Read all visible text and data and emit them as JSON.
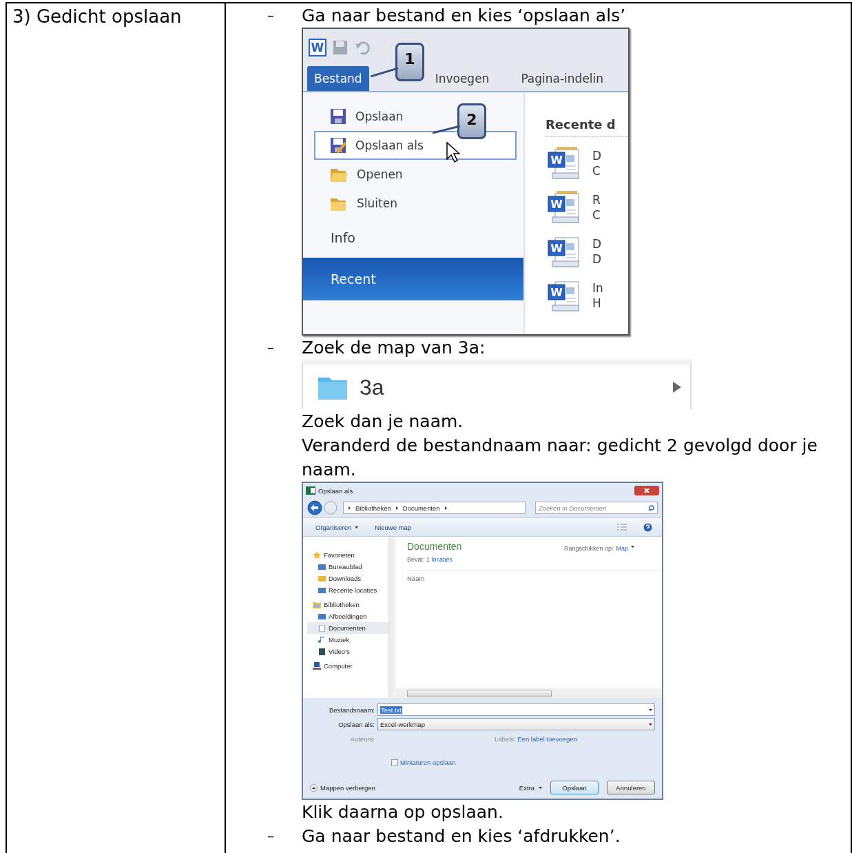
{
  "step_label": "3) Gedicht opslaan",
  "blocks": [
    {
      "kind": "bullet",
      "marker": "–",
      "text": "Ga naar bestand en kies ‘opslaan als’"
    },
    {
      "kind": "word_menu",
      "app_letter": "W",
      "tabs": [
        {
          "label": "Bestand",
          "selected": true
        },
        {
          "label": "Invoegen",
          "selected": false
        },
        {
          "label": "Pagina-indelin",
          "selected": false
        }
      ],
      "items": [
        {
          "kind": "command",
          "label": "Opslaan",
          "selected": false
        },
        {
          "kind": "command",
          "label": "Opslaan als",
          "selected": true
        },
        {
          "kind": "command",
          "label": "Openen",
          "selected": false
        },
        {
          "kind": "command",
          "label": "Sluiten",
          "selected": false
        },
        {
          "kind": "section",
          "label": "Info",
          "selected": false
        },
        {
          "kind": "section",
          "label": "Recent",
          "selected": true
        }
      ],
      "recent_heading": "Recente d",
      "recent_docs": [
        {
          "icon_letter": "W",
          "line1": "D",
          "line2": "C"
        },
        {
          "icon_letter": "W",
          "line1": "R",
          "line2": "C"
        },
        {
          "icon_letter": "W",
          "line1": "D",
          "line2": "D"
        },
        {
          "icon_letter": "W",
          "line1": "In",
          "line2": "H"
        }
      ],
      "callouts": [
        "1",
        "2"
      ]
    },
    {
      "kind": "bullet",
      "marker": "–",
      "text": "Zoek de map van 3a:"
    },
    {
      "kind": "folder_row",
      "name": "3a"
    },
    {
      "kind": "text",
      "text": "Zoek dan je naam."
    },
    {
      "kind": "text",
      "text": "Veranderd de bestandnaam naar: gedicht 2 gevolgd door je naam."
    },
    {
      "kind": "save_dialog",
      "title": "Opslaan als",
      "breadcrumbs": [
        "Bibliotheken",
        "Documenten"
      ],
      "search": {
        "placeholder": "Zoeken in Documenten"
      },
      "toolbar": [
        "Organiseren",
        "Nieuwe map"
      ],
      "nav": [
        {
          "label": "Favorieten",
          "children": [
            {
              "label": "Bureaublad",
              "selected": false
            },
            {
              "label": "Downloads",
              "selected": false
            },
            {
              "label": "Recente locaties",
              "selected": false
            }
          ]
        },
        {
          "label": "Bibliotheken",
          "children": [
            {
              "label": "Afbeeldingen",
              "selected": false
            },
            {
              "label": "Documenten",
              "selected": true
            },
            {
              "label": "Muziek",
              "selected": false
            },
            {
              "label": "Video's",
              "selected": false
            }
          ]
        },
        {
          "label": "Computer"
        }
      ],
      "library_title": "Documenten",
      "contains_label": "Bevat:",
      "contains_link": "1 locaties",
      "arrange_label": "Rangschikken op:",
      "arrange_value": "Map",
      "column": "Naam",
      "file_name": {
        "label": "Bestandsnaam:",
        "value": "Test.txt",
        "highlighted": true
      },
      "save_type": {
        "label": "Opslaan als:",
        "value": "Excel-werkmap"
      },
      "authors_label": "Auteurs:",
      "labels_label": "Labels:",
      "labels_link": "Een label toevoegen",
      "thumbnail": {
        "label": "Miniaturen opslaan",
        "checked": false
      },
      "hide_folders": "Mappen verbergen",
      "tools": "Extra",
      "buttons": [
        "Opslaan",
        "Annuleren"
      ]
    },
    {
      "kind": "text",
      "text": "Klik daarna op opslaan."
    },
    {
      "kind": "bullet",
      "marker": "–",
      "text": "Ga naar bestand en kies ‘afdrukken’."
    }
  ]
}
